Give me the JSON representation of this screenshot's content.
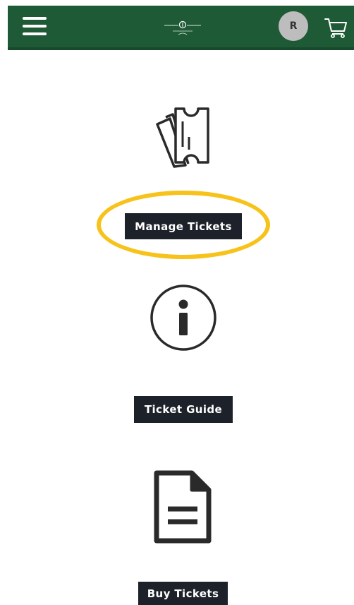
{
  "header": {
    "background": "#1f5a36",
    "menu_icon": "hamburger-menu-icon",
    "logo_icon": "tournament-logo-icon",
    "avatar_initial": "R",
    "cart_icon": "shopping-cart-icon"
  },
  "main": {
    "items": [
      {
        "icon": "tickets-icon",
        "label": "Manage Tickets",
        "highlighted": true
      },
      {
        "icon": "info-icon",
        "label": "Ticket Guide",
        "highlighted": false
      },
      {
        "icon": "document-icon",
        "label": "Buy Tickets",
        "highlighted": false
      }
    ],
    "button_color": "#1d222a",
    "highlight_color": "#f7c21a"
  }
}
